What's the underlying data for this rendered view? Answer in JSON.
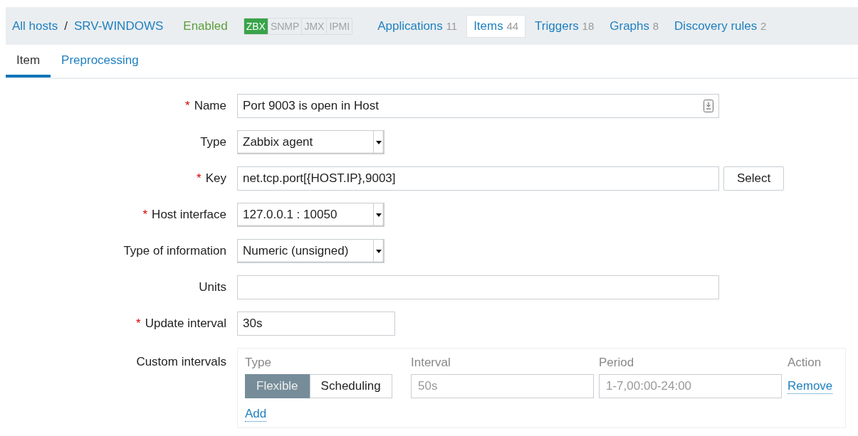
{
  "breadcrumbs": [
    {
      "label": "All hosts"
    },
    {
      "label": "SRV-WINDOWS"
    }
  ],
  "breadcrumb_separator": "/",
  "status": "Enabled",
  "required_mark": "*",
  "interfaces": [
    {
      "label": "ZBX",
      "on": true
    },
    {
      "label": "SNMP",
      "on": false
    },
    {
      "label": "JMX",
      "on": false
    },
    {
      "label": "IPMI",
      "on": false
    }
  ],
  "nav": [
    {
      "label": "Applications",
      "count": "11",
      "selected": false
    },
    {
      "label": "Items",
      "count": "44",
      "selected": true
    },
    {
      "label": "Triggers",
      "count": "18",
      "selected": false
    },
    {
      "label": "Graphs",
      "count": "8",
      "selected": false
    },
    {
      "label": "Discovery rules",
      "count": "2",
      "selected": false
    }
  ],
  "tabs": [
    {
      "label": "Item",
      "selected": true
    },
    {
      "label": "Preprocessing",
      "selected": false
    }
  ],
  "fields": [
    {
      "label": "Name",
      "required": true,
      "kind": "text",
      "value": "Port 9003 is open in Host"
    },
    {
      "label": "Type",
      "required": false,
      "kind": "select",
      "value": "Zabbix agent"
    },
    {
      "label": "Key",
      "required": true,
      "kind": "text-button",
      "value": "net.tcp.port[{HOST.IP},9003]",
      "button": "Select"
    },
    {
      "label": "Host interface",
      "required": true,
      "kind": "select",
      "value": "127.0.0.1 : 10050"
    },
    {
      "label": "Type of information",
      "required": false,
      "kind": "select",
      "value": "Numeric (unsigned)"
    },
    {
      "label": "Units",
      "required": false,
      "kind": "text-plain"
    },
    {
      "label": "Update interval",
      "required": true,
      "kind": "text-short",
      "value": "30s"
    },
    {
      "label": "Custom intervals",
      "required": false,
      "kind": "intervals",
      "columns": [
        "Type",
        "Interval",
        "Period",
        "Action"
      ],
      "rows": [
        {
          "types": [
            {
              "label": "Flexible",
              "selected": true
            },
            {
              "label": "Scheduling",
              "selected": false
            }
          ],
          "interval_placeholder": "50s",
          "period_placeholder": "1-7,00:00-24:00",
          "action": "Remove"
        }
      ],
      "add": "Add"
    }
  ]
}
